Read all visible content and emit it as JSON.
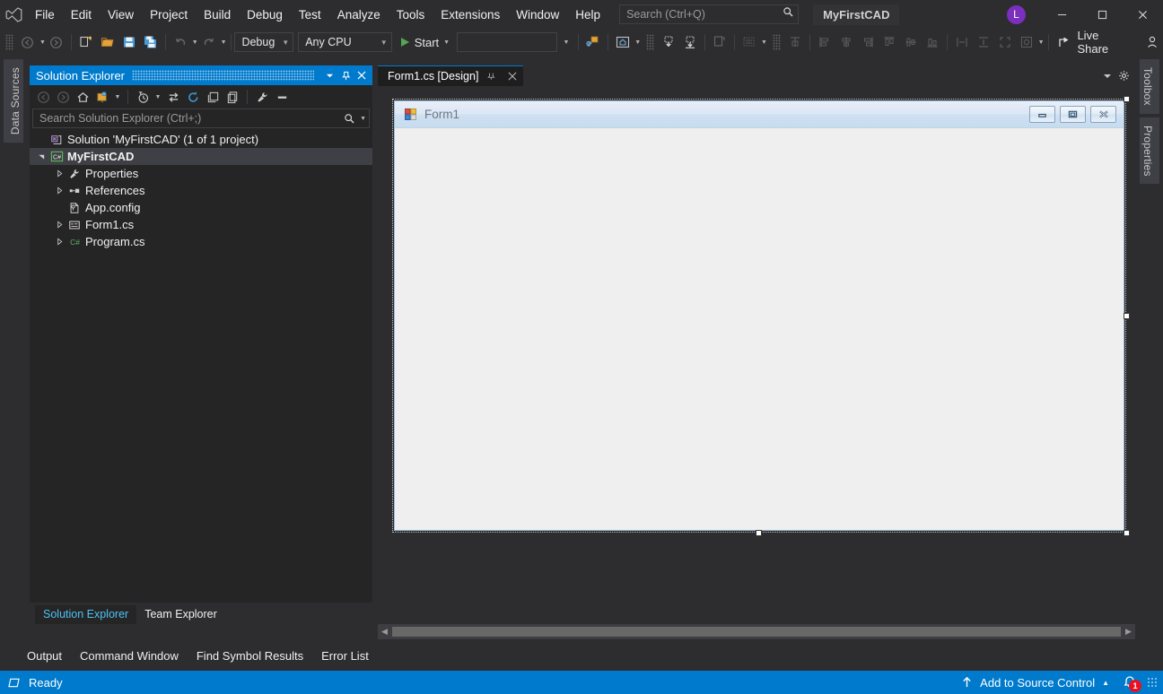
{
  "window": {
    "solution_name": "MyFirstCAD",
    "avatar_initial": "L",
    "minimize": "—",
    "maximize": "▢",
    "close": "✕"
  },
  "menu": {
    "items": [
      {
        "label": "File"
      },
      {
        "label": "Edit"
      },
      {
        "label": "View"
      },
      {
        "label": "Project"
      },
      {
        "label": "Build"
      },
      {
        "label": "Debug"
      },
      {
        "label": "Test"
      },
      {
        "label": "Analyze"
      },
      {
        "label": "Tools"
      },
      {
        "label": "Extensions"
      },
      {
        "label": "Window"
      },
      {
        "label": "Help"
      }
    ]
  },
  "search": {
    "placeholder": "Search (Ctrl+Q)",
    "icon": "search-icon"
  },
  "toolbar": {
    "configuration": "Debug",
    "platform": "Any CPU",
    "start_label": "Start",
    "live_share_label": "Live Share",
    "find_box_value": ""
  },
  "dock_left": {
    "tabs": [
      {
        "label": "Data Sources"
      }
    ]
  },
  "dock_right": {
    "tabs": [
      {
        "label": "Toolbox"
      },
      {
        "label": "Properties"
      }
    ]
  },
  "solution_explorer": {
    "title": "Solution Explorer",
    "search_placeholder": "Search Solution Explorer (Ctrl+;)",
    "tree": [
      {
        "label": "Solution 'MyFirstCAD' (1 of 1 project)",
        "indent": 0,
        "expander": "",
        "icon": "solution-icon",
        "selected": false
      },
      {
        "label": "MyFirstCAD",
        "indent": 1,
        "expander": "▼",
        "icon": "csharp-project-icon",
        "selected": true
      },
      {
        "label": "Properties",
        "indent": 2,
        "expander": "▶",
        "icon": "wrench-icon",
        "selected": false
      },
      {
        "label": "References",
        "indent": 2,
        "expander": "▶",
        "icon": "references-icon",
        "selected": false
      },
      {
        "label": "App.config",
        "indent": 2,
        "expander": "",
        "icon": "config-file-icon",
        "selected": false
      },
      {
        "label": "Form1.cs",
        "indent": 2,
        "expander": "▶",
        "icon": "form-file-icon",
        "selected": false
      },
      {
        "label": "Program.cs",
        "indent": 2,
        "expander": "▶",
        "icon": "csharp-file-icon",
        "selected": false
      }
    ],
    "bottom_tabs": [
      {
        "label": "Solution Explorer",
        "active": true
      },
      {
        "label": "Team Explorer",
        "active": false
      }
    ]
  },
  "editor": {
    "tabs": [
      {
        "label": "Form1.cs [Design]",
        "active": true
      }
    ],
    "pin_icon": "pin-icon",
    "close_icon": "close-icon"
  },
  "designer": {
    "form_title": "Form1",
    "form_icon": "winform-icon",
    "minimize_icon": "minimize-icon",
    "maximize_icon": "maximize-icon",
    "close_icon": "close-icon"
  },
  "bottom_panel": {
    "tabs": [
      {
        "label": "Output"
      },
      {
        "label": "Command Window"
      },
      {
        "label": "Find Symbol Results"
      },
      {
        "label": "Error List"
      }
    ]
  },
  "statusbar": {
    "status": "Ready",
    "source_control": "Add to Source Control",
    "notification_count": "1"
  },
  "colors": {
    "accent": "#007acc",
    "chrome": "#2d2d30",
    "panel": "#252526",
    "editor": "#1e1e1e",
    "badge_red": "#e81123",
    "avatar_purple": "#7b2fbe",
    "link_blue": "#4ec2f4"
  }
}
